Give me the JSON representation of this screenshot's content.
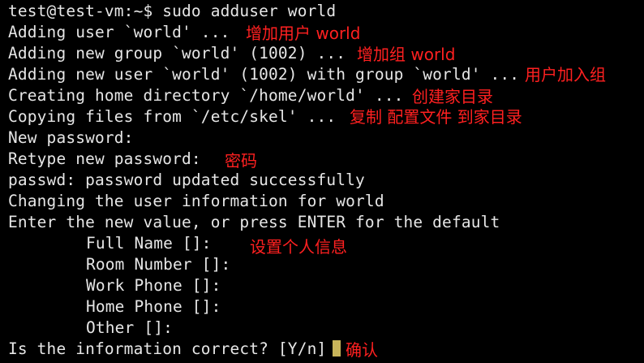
{
  "terminal": {
    "lines": [
      "test@test-vm:~$ sudo adduser world",
      "Adding user `world' ...",
      "Adding new group `world' (1002) ...",
      "Adding new user `world' (1002) with group `world' ...",
      "Creating home directory `/home/world' ...",
      "Copying files from `/etc/skel' ...",
      "New password:",
      "Retype new password:",
      "passwd: password updated successfully",
      "Changing the user information for world",
      "Enter the new value, or press ENTER for the default",
      "Full Name []:",
      "Room Number []:",
      "Work Phone []:",
      "Home Phone []:",
      "Other []:",
      "Is the information correct? [Y/n]"
    ]
  },
  "annotations": {
    "add_user": "增加用户 world",
    "add_group": "增加组 world",
    "add_user_to_group": "用户加入组",
    "create_home": "创建家目录",
    "copy_config": "复制 配置文件 到家目录",
    "password": "密码",
    "personal_info": "设置个人信息",
    "confirm": "确认"
  },
  "colors": {
    "background": "#000000",
    "text": "#e6e6e6",
    "annotation": "#ff2020",
    "cursor": "#c8b45a"
  }
}
